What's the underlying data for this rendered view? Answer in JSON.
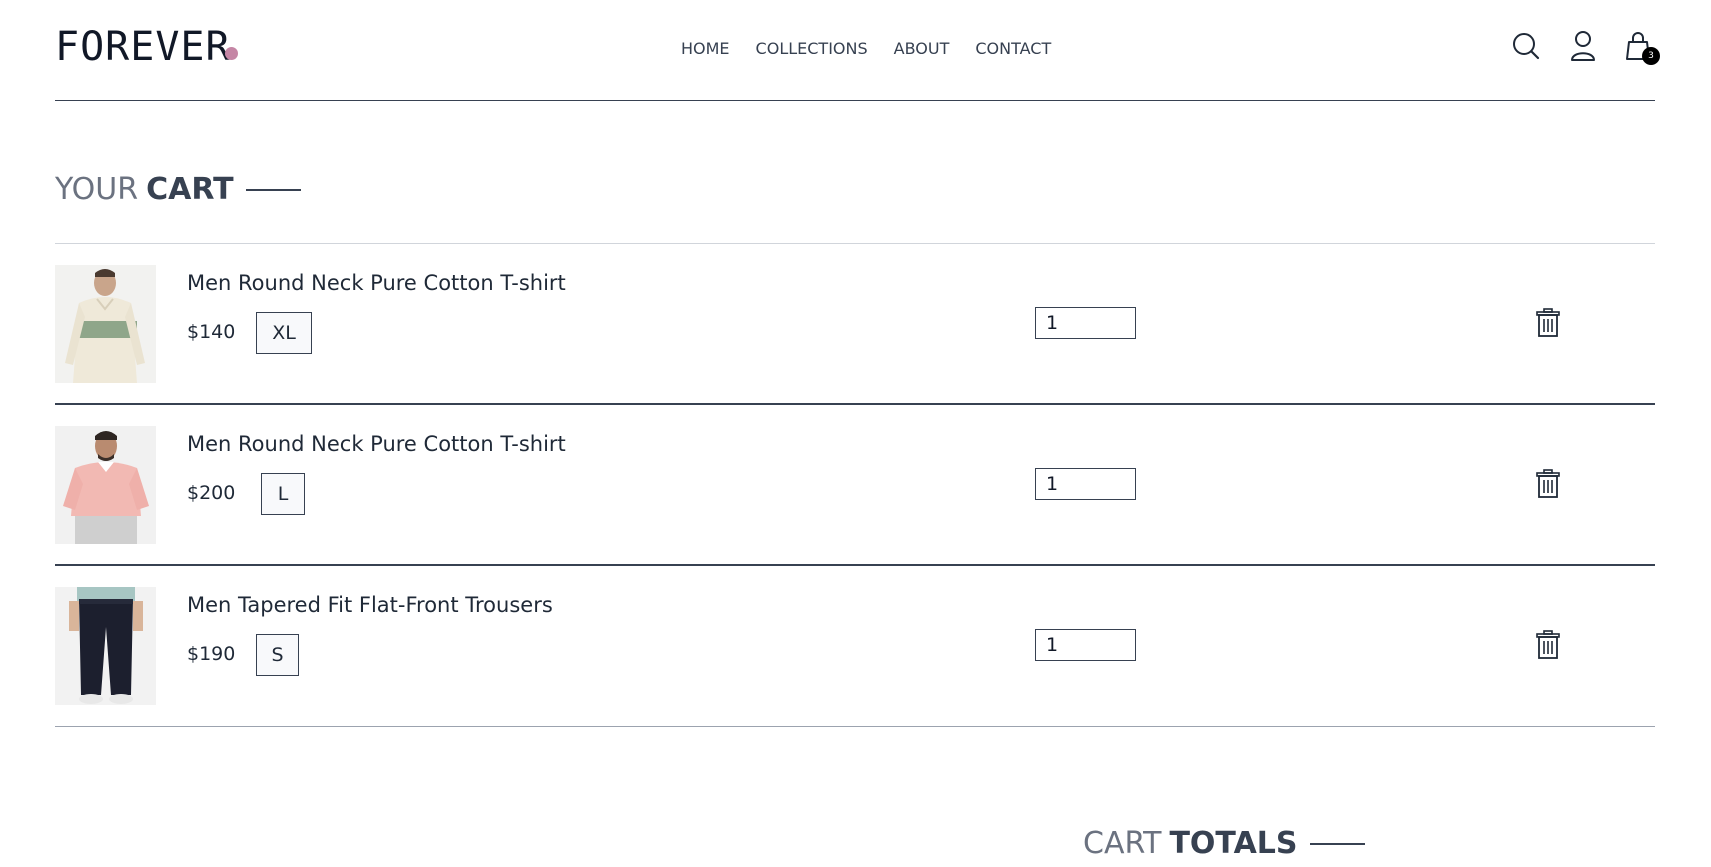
{
  "header": {
    "logo": "FOREVER",
    "nav": [
      "HOME",
      "COLLECTIONS",
      "ABOUT",
      "CONTACT"
    ],
    "cart_count": "3",
    "icons": [
      "search-icon",
      "profile-icon",
      "cart-icon"
    ]
  },
  "cart": {
    "title_light": "YOUR",
    "title_bold": "CART",
    "items": [
      {
        "name": "Men Round Neck Pure Cotton T-shirt",
        "price": "$140",
        "size": "XL",
        "quantity": "1"
      },
      {
        "name": "Men Round Neck Pure Cotton T-shirt",
        "price": "$200",
        "size": "L",
        "quantity": "1"
      },
      {
        "name": "Men Tapered Fit Flat-Front Trousers",
        "price": "$190",
        "size": "S",
        "quantity": "1"
      }
    ]
  },
  "totals": {
    "title_light": "CART",
    "title_bold": "TOTALS"
  },
  "colors": {
    "accent_dot": "#c586a5",
    "text_dark": "#374151",
    "text_light": "#6b7280"
  }
}
